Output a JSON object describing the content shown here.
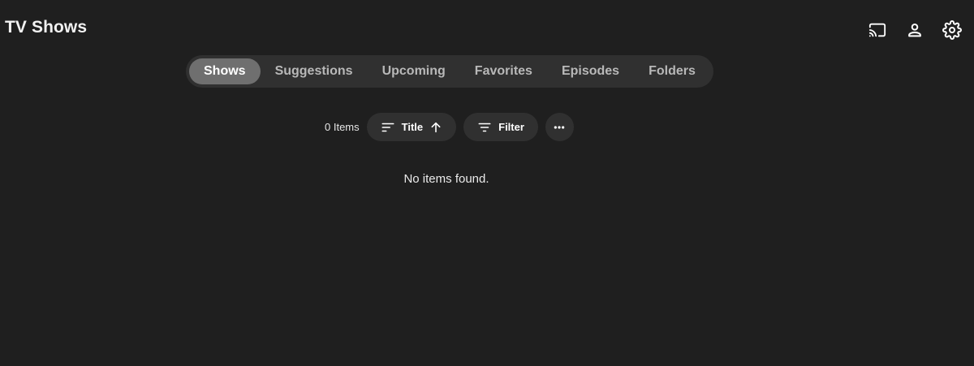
{
  "header": {
    "title": "TV Shows",
    "actions": [
      {
        "icon": "cast-icon"
      },
      {
        "icon": "user-icon"
      },
      {
        "icon": "gear-icon"
      }
    ]
  },
  "tabs": [
    {
      "label": "Shows",
      "active": true
    },
    {
      "label": "Suggestions",
      "active": false
    },
    {
      "label": "Upcoming",
      "active": false
    },
    {
      "label": "Favorites",
      "active": false
    },
    {
      "label": "Episodes",
      "active": false
    },
    {
      "label": "Folders",
      "active": false
    }
  ],
  "toolbar": {
    "item_count": "0 Items",
    "sort_label": "Title",
    "sort_direction_icon": "arrow-up-icon",
    "filter_label": "Filter",
    "more_icon": "more-horizontal-icon"
  },
  "content": {
    "empty_message": "No items found."
  },
  "colors": {
    "background": "#1f1f1f",
    "pill": "#303030",
    "active_tab": "#6f6f6f",
    "inactive_text": "#b8b8b8"
  }
}
